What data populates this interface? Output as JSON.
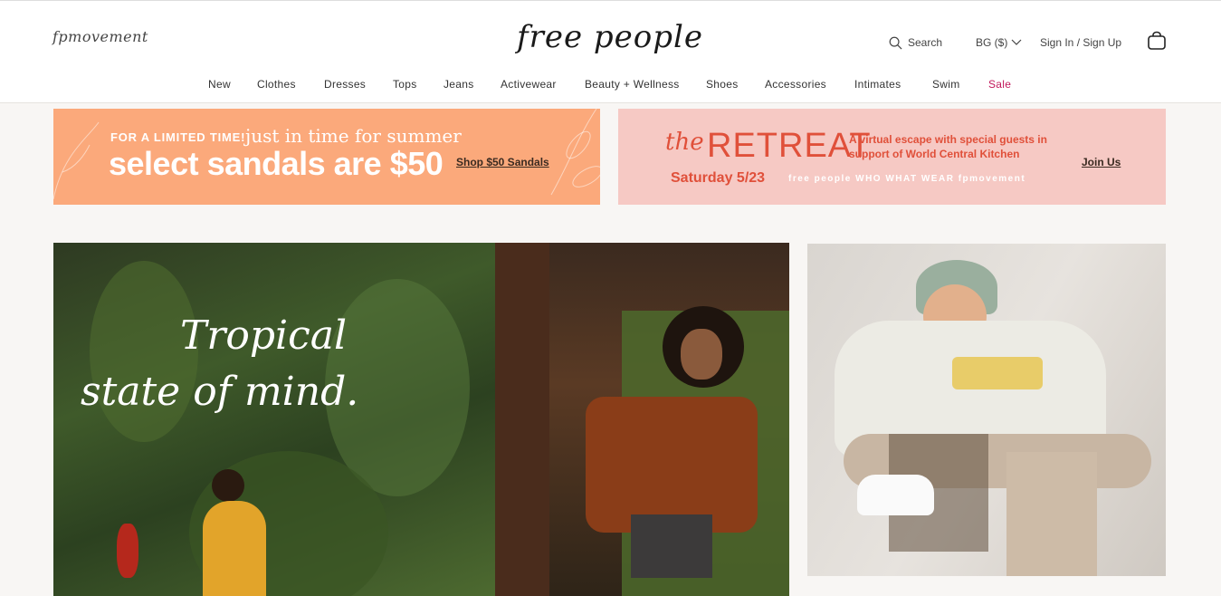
{
  "header": {
    "fpm_logo": "fpmovement",
    "brand_logo": "free people",
    "search_label": "Search",
    "region_label": "BG ($)",
    "signin_label": "Sign In / Sign Up"
  },
  "nav": {
    "items": [
      "New",
      "Clothes",
      "Dresses",
      "Tops",
      "Jeans",
      "Activewear",
      "Beauty + Wellness",
      "Shoes",
      "Accessories",
      "Intimates",
      "Swim",
      "Sale"
    ]
  },
  "promo_left": {
    "kicker": "FOR A LIMITED TIME!",
    "kicker_script": "just in time for summer",
    "headline": "select sandals are $50",
    "link": "Shop $50 Sandals"
  },
  "promo_right": {
    "the": "the",
    "title": "RETREAT",
    "description": "A virtual escape with special guests in support of World Central Kitchen",
    "date": "Saturday 5/23",
    "partners": "free people  WHO WHAT WEAR  fpmovement",
    "link": "Join Us"
  },
  "hero": {
    "script_line1": "Tropical",
    "script_line2": "state of mind."
  },
  "colors": {
    "sale": "#c2185b",
    "promo_left_bg": "#fba97b",
    "promo_right_bg": "#f6c9c4",
    "retreat_red": "#e0503a"
  }
}
